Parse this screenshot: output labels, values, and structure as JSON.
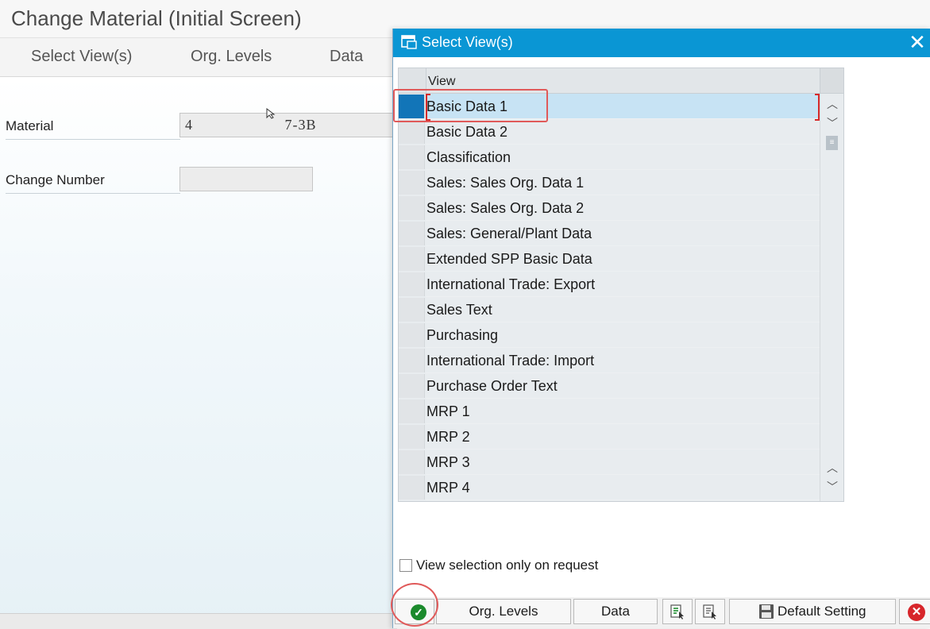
{
  "background": {
    "title": "Change Material (Initial Screen)",
    "toolbar": [
      "Select View(s)",
      "Org. Levels",
      "Data"
    ],
    "fields": {
      "material_label": "Material",
      "material_value": "4                     7-3B",
      "change_number_label": "Change Number",
      "change_number_value": ""
    }
  },
  "dialog": {
    "title": "Select View(s)",
    "column_header": "View",
    "views": [
      "Basic Data 1",
      "Basic Data 2",
      "Classification",
      "Sales: Sales Org. Data 1",
      "Sales: Sales Org. Data 2",
      "Sales: General/Plant Data",
      "Extended SPP Basic Data",
      "International Trade: Export",
      "Sales Text",
      "Purchasing",
      "International Trade: Import",
      "Purchase Order Text",
      "MRP 1",
      "MRP 2",
      "MRP 3",
      "MRP 4"
    ],
    "selected_view": "Basic Data 1",
    "checkbox_label": "View selection only on request",
    "checkbox_checked": false,
    "buttons": {
      "org_levels": "Org. Levels",
      "data": "Data",
      "default_setting": "Default Setting"
    },
    "colors": {
      "title_bar": "#0a96d4",
      "selected_row": "#c7e3f4",
      "selected_marker": "#1275b8",
      "annotation": "#e05a5a"
    }
  }
}
